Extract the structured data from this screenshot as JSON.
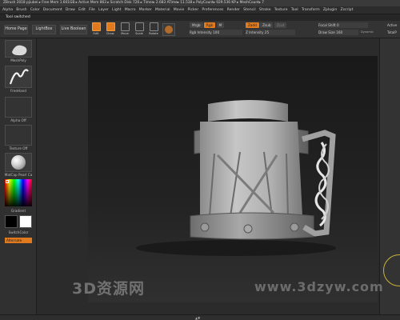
{
  "title_bar": {
    "text": "ZBrush 2018   pjiubei   ▸ Free Mem 1.601GB ▸ Active Mem 863 ▸ Scratch Disk 726 ▸ Timer▸ 2.683 ATime▸ 11.538 ▸ PolyCount▸ 929.536 KP ▸ MeshCount▸ 7"
  },
  "menu": [
    "Alpha",
    "Brush",
    "Color",
    "Document",
    "Draw",
    "Edit",
    "File",
    "Layer",
    "Light",
    "Macro",
    "Marker",
    "Material",
    "Movie",
    "Picker",
    "Preferences",
    "Render",
    "Stencil",
    "Stroke",
    "Texture",
    "Tool",
    "Transform",
    "Zplugin",
    "Zscript"
  ],
  "notice": "Tool switched",
  "toolbar": {
    "home_page": "Home Page",
    "lightbox": "LightBox",
    "live_boolean": "Live Boolean",
    "edit": "Edit",
    "draw": "Draw",
    "move": "Move",
    "scale": "Scale",
    "rotate": "Rotate",
    "mrgb": "Mrgb",
    "rgb": "Rgb",
    "m": "M",
    "rgb_intensity_label": "Rgb Intensity",
    "rgb_intensity_value": "100",
    "zadd": "Zadd",
    "zsub": "Zsub",
    "zcut": "Zcut",
    "z_intensity_label": "Z Intensity",
    "z_intensity_value": "25",
    "focal_shift_label": "Focal Shift",
    "focal_shift_value": "0",
    "draw_size_label": "Draw Size",
    "draw_size_value": "160",
    "dynamic": "Dynamic",
    "active": "Active",
    "total": "TotalP"
  },
  "sidebar": {
    "brush_label": "MeshPoly",
    "stroke_label": "FreeHand",
    "alpha_label": "Alpha Off",
    "texture_label": "Texture Off",
    "material_label": "MatCap Pearl Ca",
    "gradient_label": "Gradient",
    "switch_color_label": "SwitchColor",
    "alternate_label": "Alternate"
  },
  "watermark": {
    "text_cn": "3D资源网",
    "text_url": "www.3dzyw.com"
  },
  "colors": {
    "accent": "#e07a1f"
  }
}
